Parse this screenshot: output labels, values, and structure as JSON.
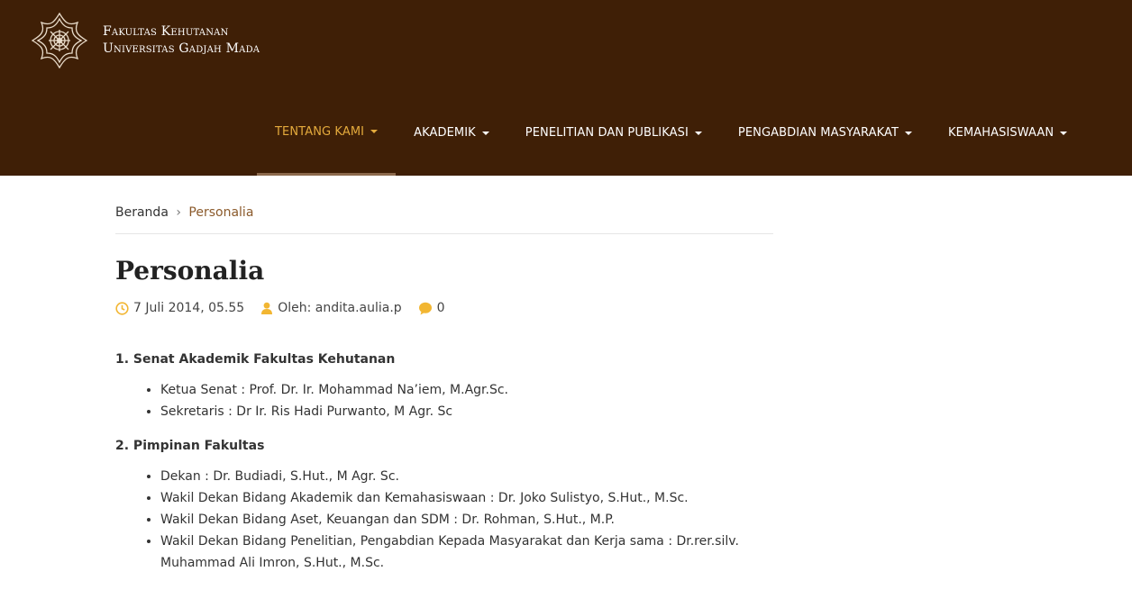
{
  "brand": {
    "line1": "Fakultas Kehutanan",
    "line2": "Universitas Gadjah Mada"
  },
  "nav": {
    "items": [
      {
        "label": "TENTANG KAMI"
      },
      {
        "label": "AKADEMIK"
      },
      {
        "label": "PENELITIAN DAN PUBLIKASI"
      },
      {
        "label": "PENGABDIAN MASYARAKAT"
      },
      {
        "label": "KEMAHASISWAAN"
      }
    ]
  },
  "breadcrumb": {
    "home": "Beranda",
    "separator": "›",
    "current": "Personalia"
  },
  "article": {
    "title": "Personalia",
    "meta": {
      "date": "7 Juli 2014, 05.55",
      "author": "Oleh: andita.aulia.p",
      "comments": "0"
    },
    "sections": [
      {
        "title": "1. Senat Akademik Fakultas Kehutanan",
        "items": [
          "Ketua Senat : Prof. Dr. Ir. Mohammad Na’iem, M.Agr.Sc.",
          "Sekretaris :  Dr Ir. Ris Hadi Purwanto, M Agr. Sc"
        ]
      },
      {
        "title": "2. Pimpinan Fakultas",
        "items": [
          "Dekan : Dr. Budiadi, S.Hut., M Agr. Sc.",
          "Wakil Dekan Bidang Akademik dan Kemahasiswaan : Dr. Joko Sulistyo, S.Hut., M.Sc.",
          "Wakil Dekan Bidang Aset, Keuangan dan SDM : Dr. Rohman, S.Hut., M.P.",
          "Wakil Dekan Bidang Penelitian, Pengabdian Kepada Masyarakat dan Kerja sama : Dr.rer.silv. Muhammad Ali Imron, S.Hut., M.Sc."
        ]
      }
    ]
  },
  "colors": {
    "header_bg": "#3f1f06",
    "nav_active": "#e4aa3c",
    "breadcrumb_current": "#8b5a2b",
    "meta_icon": "#f2b632"
  }
}
